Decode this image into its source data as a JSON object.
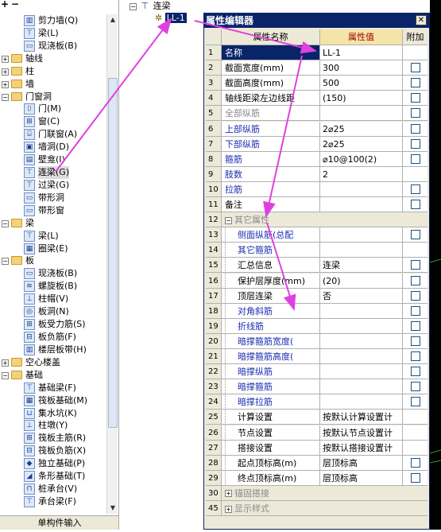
{
  "tree": {
    "top_icons": [
      "+",
      "−"
    ],
    "bottom_label": "单构件输入",
    "items": [
      {
        "label": "剪力墙(Q)",
        "level": 2,
        "icon": "shear-wall-icon",
        "glyph": "▥"
      },
      {
        "label": "梁(L)",
        "level": 2,
        "icon": "beam-icon",
        "glyph": "⊤"
      },
      {
        "label": "现浇板(B)",
        "level": 2,
        "icon": "slab-icon",
        "glyph": "▭"
      },
      {
        "label": "轴线",
        "level": 0,
        "folder": true,
        "expander": "+"
      },
      {
        "label": "柱",
        "level": 0,
        "folder": true,
        "expander": "+"
      },
      {
        "label": "墙",
        "level": 0,
        "folder": true,
        "expander": "+"
      },
      {
        "label": "门窗洞",
        "level": 0,
        "folder": true,
        "expander": "−"
      },
      {
        "label": "门(M)",
        "level": 1,
        "icon": "door-icon",
        "glyph": "⌷"
      },
      {
        "label": "窗(C)",
        "level": 1,
        "icon": "window-icon",
        "glyph": "⊞"
      },
      {
        "label": "门联窗(A)",
        "level": 1,
        "icon": "door-window-icon",
        "glyph": "⌸"
      },
      {
        "label": "墙洞(D)",
        "level": 1,
        "icon": "wall-hole-icon",
        "glyph": "▣"
      },
      {
        "label": "壁龛(I)",
        "level": 1,
        "icon": "niche-icon",
        "glyph": "▤"
      },
      {
        "label": "连梁(G)",
        "level": 1,
        "icon": "coupling-beam-icon",
        "glyph": "⊤",
        "selected": true
      },
      {
        "label": "过梁(G)",
        "level": 1,
        "icon": "lintel-icon",
        "glyph": "⊤"
      },
      {
        "label": "带形洞",
        "level": 1,
        "icon": "strip-opening-icon",
        "glyph": "▭"
      },
      {
        "label": "带形窗",
        "level": 1,
        "icon": "strip-window-icon",
        "glyph": "▭"
      },
      {
        "label": "梁",
        "level": 0,
        "folder": true,
        "expander": "−"
      },
      {
        "label": "梁(L)",
        "level": 1,
        "icon": "beam-icon",
        "glyph": "⊤"
      },
      {
        "label": "圈梁(E)",
        "level": 1,
        "icon": "ring-beam-icon",
        "glyph": "▦"
      },
      {
        "label": "板",
        "level": 0,
        "folder": true,
        "expander": "−"
      },
      {
        "label": "现浇板(B)",
        "level": 1,
        "icon": "slab-icon",
        "glyph": "▭"
      },
      {
        "label": "螺旋板(B)",
        "level": 1,
        "icon": "spiral-slab-icon",
        "glyph": "≋"
      },
      {
        "label": "柱帽(V)",
        "level": 1,
        "icon": "column-cap-icon",
        "glyph": "⊥"
      },
      {
        "label": "板洞(N)",
        "level": 1,
        "icon": "slab-hole-icon",
        "glyph": "◎"
      },
      {
        "label": "板受力筋(S)",
        "level": 1,
        "icon": "slab-rebar-icon",
        "glyph": "⊞"
      },
      {
        "label": "板负筋(F)",
        "level": 1,
        "icon": "negative-rebar-icon",
        "glyph": "⊟"
      },
      {
        "label": "楼层板带(H)",
        "level": 1,
        "icon": "floor-strip-icon",
        "glyph": "▥"
      },
      {
        "label": "空心楼盖",
        "level": 0,
        "folder": true,
        "expander": "+"
      },
      {
        "label": "基础",
        "level": 0,
        "folder": true,
        "expander": "−"
      },
      {
        "label": "基础梁(F)",
        "level": 1,
        "icon": "foundation-beam-icon",
        "glyph": "⊤"
      },
      {
        "label": "筏板基础(M)",
        "level": 1,
        "icon": "raft-foundation-icon",
        "glyph": "▦"
      },
      {
        "label": "集水坑(K)",
        "level": 1,
        "icon": "sump-pit-icon",
        "glyph": "⊔"
      },
      {
        "label": "柱墩(Y)",
        "level": 1,
        "icon": "column-pier-icon",
        "glyph": "⊥"
      },
      {
        "label": "筏板主筋(R)",
        "level": 1,
        "icon": "raft-main-rebar-icon",
        "glyph": "⊞"
      },
      {
        "label": "筏板负筋(X)",
        "level": 1,
        "icon": "raft-negative-rebar-icon",
        "glyph": "⊟"
      },
      {
        "label": "独立基础(P)",
        "level": 1,
        "icon": "isolated-foundation-icon",
        "glyph": "◆"
      },
      {
        "label": "条形基础(T)",
        "level": 1,
        "icon": "strip-foundation-icon",
        "glyph": "◢"
      },
      {
        "label": "桩承台(V)",
        "level": 1,
        "icon": "pile-cap-icon",
        "glyph": "⊓"
      },
      {
        "label": "承台梁(F)",
        "level": 1,
        "icon": "cap-beam-icon",
        "glyph": "⊤"
      }
    ]
  },
  "component": {
    "parent": "连梁",
    "child": "LL-1"
  },
  "editor": {
    "title": "属性编辑器",
    "close": "✕",
    "headers": {
      "name": "属性名称",
      "value": "属性值",
      "add": "附加"
    },
    "rows": [
      {
        "num": "1",
        "name": "名称",
        "value": "LL-1",
        "color": "blue",
        "check": false,
        "selected": true
      },
      {
        "num": "2",
        "name": "截面宽度(mm)",
        "value": "300",
        "color": "black",
        "check": true
      },
      {
        "num": "3",
        "name": "截面高度(mm)",
        "value": "500",
        "color": "black",
        "check": true
      },
      {
        "num": "4",
        "name": "轴线距梁左边线距",
        "value": "(150)",
        "color": "black",
        "check": true
      },
      {
        "num": "5",
        "name": "全部纵筋",
        "value": "",
        "color": "gray",
        "check": true
      },
      {
        "num": "6",
        "name": "上部纵筋",
        "value": "2⌀25",
        "color": "blue",
        "check": true
      },
      {
        "num": "7",
        "name": "下部纵筋",
        "value": "2⌀25",
        "color": "blue",
        "check": true
      },
      {
        "num": "8",
        "name": "箍筋",
        "value": "⌀10@100(2)",
        "color": "blue",
        "check": true
      },
      {
        "num": "9",
        "name": "肢数",
        "value": "2",
        "color": "blue",
        "check": false
      },
      {
        "num": "10",
        "name": "拉筋",
        "value": "",
        "color": "blue",
        "check": true
      },
      {
        "num": "11",
        "name": "备注",
        "value": "",
        "color": "black",
        "check": true
      },
      {
        "num": "12",
        "name": "其它属性",
        "group": true,
        "expander": "−"
      },
      {
        "num": "13",
        "name": "侧面纵筋(总配",
        "value": "",
        "color": "blue",
        "check": true,
        "indent": true
      },
      {
        "num": "14",
        "name": "其它箍筋",
        "value": "",
        "color": "blue",
        "check": false,
        "indent": true
      },
      {
        "num": "15",
        "name": "汇总信息",
        "value": "连梁",
        "color": "black",
        "check": true,
        "indent": true
      },
      {
        "num": "16",
        "name": "保护层厚度(mm)",
        "value": "(20)",
        "color": "black",
        "check": true,
        "indent": true
      },
      {
        "num": "17",
        "name": "顶层连梁",
        "value": "否",
        "color": "black",
        "check": true,
        "indent": true
      },
      {
        "num": "18",
        "name": "对角斜筋",
        "value": "",
        "color": "blue",
        "check": true,
        "indent": true
      },
      {
        "num": "19",
        "name": "折线筋",
        "value": "",
        "color": "blue",
        "check": true,
        "indent": true
      },
      {
        "num": "20",
        "name": "暗撑箍筋宽度(",
        "value": "",
        "color": "blue",
        "check": true,
        "indent": true
      },
      {
        "num": "21",
        "name": "暗撑箍筋高度(",
        "value": "",
        "color": "blue",
        "check": true,
        "indent": true
      },
      {
        "num": "22",
        "name": "暗撑纵筋",
        "value": "",
        "color": "blue",
        "check": true,
        "indent": true
      },
      {
        "num": "23",
        "name": "暗撑箍筋",
        "value": "",
        "color": "blue",
        "check": true,
        "indent": true
      },
      {
        "num": "24",
        "name": "暗撑拉筋",
        "value": "",
        "color": "blue",
        "check": true,
        "indent": true
      },
      {
        "num": "25",
        "name": "计算设置",
        "value": "按默认计算设置计",
        "color": "black",
        "check": false,
        "indent": true
      },
      {
        "num": "26",
        "name": "节点设置",
        "value": "按默认节点设置计",
        "color": "black",
        "check": false,
        "indent": true
      },
      {
        "num": "27",
        "name": "搭接设置",
        "value": "按默认搭接设置计",
        "color": "black",
        "check": false,
        "indent": true
      },
      {
        "num": "28",
        "name": "起点顶标高(m)",
        "value": "层顶标高",
        "color": "black",
        "check": true,
        "indent": true
      },
      {
        "num": "29",
        "name": "终点顶标高(m)",
        "value": "层顶标高",
        "color": "black",
        "check": true,
        "indent": true
      },
      {
        "num": "30",
        "name": "锚固搭接",
        "group": true,
        "expander": "+"
      },
      {
        "num": "45",
        "name": "显示样式",
        "group": true,
        "expander": "+"
      }
    ]
  },
  "colors": {
    "annotation_arrow": "#e040e0",
    "title_bar": "#0a246a",
    "blue_text": "#1a2db0",
    "gray_text": "#8a8a8a"
  }
}
